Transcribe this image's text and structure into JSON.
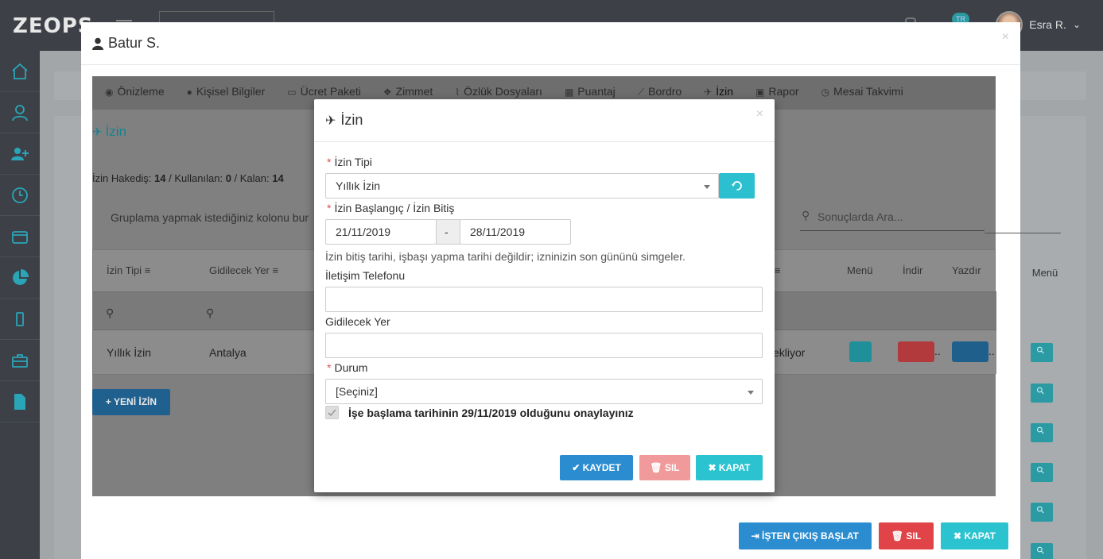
{
  "app": {
    "logo": "ZEOPS"
  },
  "topbar": {
    "user_name": "Esra R.",
    "lang": "TR",
    "chevron": "⌄"
  },
  "sidebar": {
    "items": [
      {
        "icon": "home-icon"
      },
      {
        "icon": "users-icon"
      },
      {
        "icon": "user-add-icon"
      },
      {
        "icon": "clock-icon"
      },
      {
        "icon": "wallet-icon"
      },
      {
        "icon": "pie-chart-icon"
      },
      {
        "icon": "mobile-icon"
      },
      {
        "icon": "briefcase-icon"
      },
      {
        "icon": "document-icon"
      }
    ]
  },
  "employee_modal": {
    "title": "Batur S.",
    "close": "×",
    "tabs": [
      {
        "label": "Önizleme",
        "icon": "eye-icon"
      },
      {
        "label": "Kişisel Bilgiler",
        "icon": "user-icon"
      },
      {
        "label": "Ücret Paketi",
        "icon": "money-icon"
      },
      {
        "label": "Zimmet",
        "icon": "cubes-icon"
      },
      {
        "label": "Özlük Dosyaları",
        "icon": "paperclip-icon"
      },
      {
        "label": "Puantaj",
        "icon": "calendar-icon"
      },
      {
        "label": "Bordro",
        "icon": "line-chart-icon"
      },
      {
        "label": "İzin",
        "icon": "plane-icon",
        "active": true
      },
      {
        "label": "Rapor",
        "icon": "medkit-icon"
      },
      {
        "label": "Mesai Takvimi",
        "icon": "clock-icon"
      }
    ],
    "section_title": "İzin",
    "summary": {
      "hakedis_label": "İzin Hakediş:",
      "hakedis": "14",
      "kullanilan_label": " / Kullanılan:",
      "kullanilan": "0",
      "kalan_label": " / Kalan:",
      "kalan": "14"
    },
    "group_hint": "Gruplama yapmak istediğiniz kolonu bur",
    "search_placeholder": "Sonuçlarda Ara...",
    "grid": {
      "headers": {
        "izin_tipi": "İzin Tipi",
        "gidilecek_yer": "Gidilecek Yer",
        "menu": "Menü",
        "indir": "İndir",
        "yazdir": "Yazdır"
      },
      "outer_menu_header": "Menü",
      "row": {
        "izin_tipi": "Yıllık İzin",
        "gidilecek_yer": "Antalya",
        "durum_partial": "ekliyor",
        "ellipsis": ".."
      }
    },
    "new_button": "YENİ İZİN",
    "footer": {
      "exit": "İŞTEN ÇIKIŞ BAŞLAT",
      "delete": "SIL",
      "close": "KAPAT"
    }
  },
  "leave_modal": {
    "title": "İzin",
    "close": "×",
    "izin_tipi_label": "İzin Tipi",
    "izin_tipi_value": "Yıllık İzin",
    "dates_label": "İzin Başlangıç / İzin Bitiş",
    "start_date": "21/11/2019",
    "date_sep": "-",
    "end_date": "28/11/2019",
    "hint": "İzin bitiş tarihi, işbaşı yapma tarihi değildir; izninizin son gününü simgeler.",
    "phone_label": "İletişim Telefonu",
    "phone_value": "",
    "destination_label": "Gidilecek Yer",
    "destination_value": "",
    "status_label": "Durum",
    "status_value": "[Seçiniz]",
    "confirm_text": "İşe başlama tarihinin 29/11/2019 olduğunu onaylayınız",
    "save": "KAYDET",
    "delete": "SIL",
    "close_btn": "KAPAT"
  }
}
